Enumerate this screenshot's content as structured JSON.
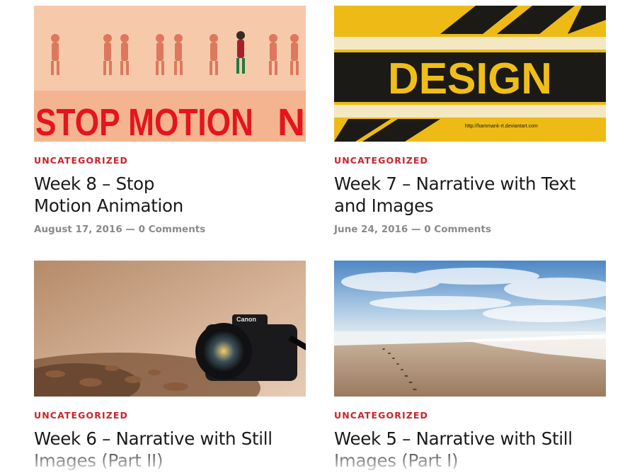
{
  "posts": [
    {
      "category": "UNCATEGORIZED",
      "title_line1": "Week 8 – Stop",
      "title_line2": "Motion Animation",
      "date": "August 17, 2016",
      "separator": "—",
      "comments": "0 Comments",
      "image": {
        "text": "STOP MOTION",
        "text2": "N",
        "bg": "#f6c6a6",
        "text_color": "#e5141d"
      }
    },
    {
      "category": "UNCATEGORIZED",
      "title_line1": "Week 7 – Narrative with Text",
      "title_line2": "and Images",
      "date": "June 24, 2016",
      "separator": "—",
      "comments": "0 Comments",
      "image": {
        "text": "DESIGN",
        "credit": "http://hammank-rt.deviantart.com",
        "bg": "#f2c21b",
        "text_color": "#1c1a16"
      }
    },
    {
      "category": "UNCATEGORIZED",
      "title_line1": "Week 6 – Narrative with Still",
      "title_line2": "Images (Part II)",
      "image": {
        "brand": "Canon",
        "bg": "#c9a184"
      }
    },
    {
      "category": "UNCATEGORIZED",
      "title_line1": "Week 5 – Narrative with Still",
      "title_line2": "Images (Part I)",
      "image": {
        "sky": "#5a8fc7",
        "sand": "#a5856a"
      }
    }
  ],
  "colors": {
    "accent": "#c8242b",
    "title": "#1a1a1a",
    "meta": "#8a8a8a"
  }
}
